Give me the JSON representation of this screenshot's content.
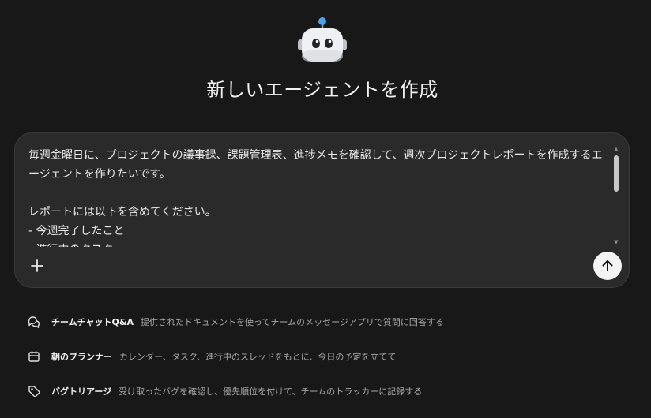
{
  "logo": {
    "icon": "robot-icon",
    "accent": "#4aa3f0"
  },
  "title": "新しいエージェントを作成",
  "composer": {
    "text": "毎週金曜日に、プロジェクトの議事録、課題管理表、進捗メモを確認して、週次プロジェクトレポートを作成するエージェントを作りたいです。\n\nレポートには以下を含めてください。\n- 今週完了したこと\n- 進行中のタスク",
    "plus_icon": "plus-icon",
    "send_icon": "arrow-up-icon"
  },
  "suggestions": [
    {
      "icon": "chat-bubbles-icon",
      "title": "チームチャットQ&A",
      "description": "提供されたドキュメントを使ってチームのメッセージアプリで質問に回答する"
    },
    {
      "icon": "calendar-icon",
      "title": "朝のプランナー",
      "description": "カレンダー、タスク、進行中のスレッドをもとに、今日の予定を立てて"
    },
    {
      "icon": "tag-icon",
      "title": "バグトリアージ",
      "description": "受け取ったバグを確認し、優先順位を付けて、チームのトラッカーに記録する"
    }
  ]
}
